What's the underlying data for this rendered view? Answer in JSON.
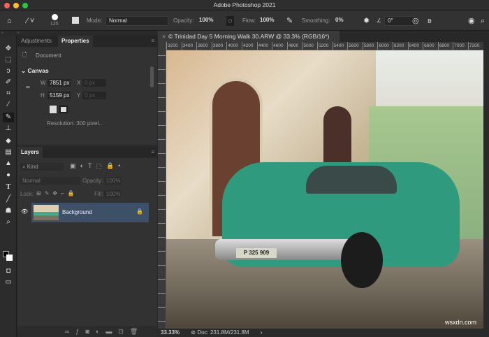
{
  "window": {
    "title": "Adobe Photoshop 2021"
  },
  "options_bar": {
    "brush_size": "125",
    "mode_label": "Mode:",
    "mode_value": "Normal",
    "opacity_label": "Opacity:",
    "opacity_value": "100%",
    "flow_label": "Flow:",
    "flow_value": "100%",
    "smoothing_label": "Smoothing:",
    "smoothing_value": "0%",
    "angle_value": "0°"
  },
  "properties_panel": {
    "tabs": [
      "Adjustments",
      "Properties"
    ],
    "document_label": "Document",
    "canvas_heading": "Canvas",
    "w_label": "W",
    "w_value": "7851 px",
    "h_label": "H",
    "h_value": "5159 px",
    "x_label": "X",
    "x_value": "0 px",
    "y_label": "Y",
    "y_value": "0 px",
    "resolution": "Resolution: 300 pixel..."
  },
  "layers_panel": {
    "tab": "Layers",
    "filter_kind": "Kind",
    "blend_mode": "Normal",
    "opacity_label": "Opacity:",
    "opacity_value": "100%",
    "lock_label": "Lock:",
    "fill_label": "Fill:",
    "fill_value": "100%",
    "layers": [
      {
        "name": "Background",
        "locked": true,
        "visible": true
      }
    ]
  },
  "document": {
    "tab_title": "© Trinidad Day 5 Morning Walk 30.ARW @ 33.3% (RGB/16*)",
    "ruler_labels": [
      "3200",
      "3400",
      "3600",
      "3800",
      "4000",
      "4200",
      "4400",
      "4600",
      "4800",
      "5000",
      "5200",
      "5400",
      "5600",
      "5800",
      "6000",
      "6200",
      "6400",
      "6600",
      "6800",
      "7000",
      "7200"
    ],
    "license_plate": "P 325 909"
  },
  "status_bar": {
    "zoom": "33.33%",
    "doc_info": "Doc: 231.8M/231.8M"
  },
  "watermark": "wsxdn.com"
}
